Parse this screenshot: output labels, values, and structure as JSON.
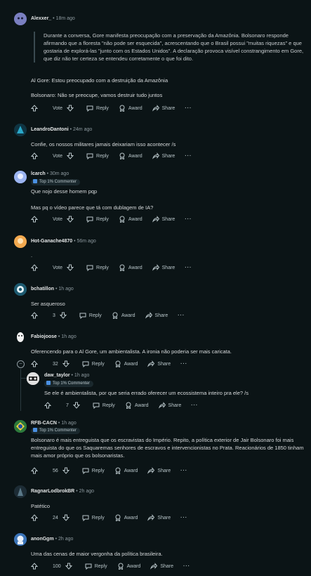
{
  "comments": [
    {
      "author": "Alexxer_",
      "time": "• 18m ago",
      "quote": "Durante a conversa, Gore manifesta preocupação com a preservação da Amazônia. Bolsonaro responde afirmando que a floresta \"não pode ser esquecida\", acrescentando que o Brasil possui \"muitas riquezas\" e que gostaria de explorá-las \"junto com os Estados Unidos\". A declaração provoca visível constrangimento em Gore, que diz não ter certeza se entendeu corretamente o que foi dito.",
      "lines": [
        "Al Gore: Estou preocupado com a destruição da Amazônia",
        "Bolsonaro: Não se preocupe, vamos destruir tudo juntos"
      ],
      "votes": "Vote"
    },
    {
      "author": "LeandroDantoni",
      "time": "• 24m ago",
      "lines": [
        "Confie, os nossos militares jamais deixariam isso acontecer /s"
      ],
      "votes": "Vote"
    },
    {
      "author": "lcarch",
      "time": "• 30m ago",
      "badge": "Top 1% Commenter",
      "lines": [
        "Que nojo desse homem pqp",
        "Mas pq o vídeo parece que tá com dublagem de IA?"
      ],
      "votes": "Vote"
    },
    {
      "author": "Hot-Ganache4870",
      "time": "• 56m ago",
      "lines": [
        "."
      ],
      "votes": "Vote"
    },
    {
      "author": "bchatillon",
      "time": "• 1h ago",
      "lines": [
        "Ser asqueroso"
      ],
      "votes": "3"
    },
    {
      "author": "Fabiojoose",
      "time": "• 1h ago",
      "lines": [
        "Oferencendo para o Al Gore, um ambientalista. A ironia não poderia ser mais caricata."
      ],
      "votes": "32"
    },
    {
      "author": "daw_taylor",
      "time": "• 1h ago",
      "badge": "Top 1% Commenter",
      "lines": [
        "Se ele é ambientalista, por que seria errado oferecer um ecossistema inteiro pra ele? /s"
      ],
      "votes": "7"
    },
    {
      "author": "RFB-CACN",
      "time": "• 1h ago",
      "badge": "Top 1% Commenter",
      "lines": [
        "Bolsonaro é mais entreguista que os escravistas do Império. Repito, a política exterior de Jair Bolsonaro foi mais entreguista do que os Saquaremas senhores de escravos e intervencionistas no Prata. Reacionários de 1850 tinham mais amor próprio que os bolsonaristas."
      ],
      "votes": "56"
    },
    {
      "author": "RagnarLodbrokBR",
      "time": "• 2h ago",
      "lines": [
        "Patético"
      ],
      "votes": "24"
    },
    {
      "author": "anonGgm",
      "time": "• 2h ago",
      "lines": [
        "Uma das cenas de maior vergonha da política brasileira."
      ],
      "votes": "100"
    }
  ],
  "actions": {
    "reply": "Reply",
    "award": "Award",
    "share": "Share",
    "more": "···"
  },
  "collapse_symbol": "−",
  "colors": {
    "background": "#0b1416",
    "text": "#d7dadc",
    "muted": "#8e9aa0",
    "badge_bg": "#1a282d"
  }
}
